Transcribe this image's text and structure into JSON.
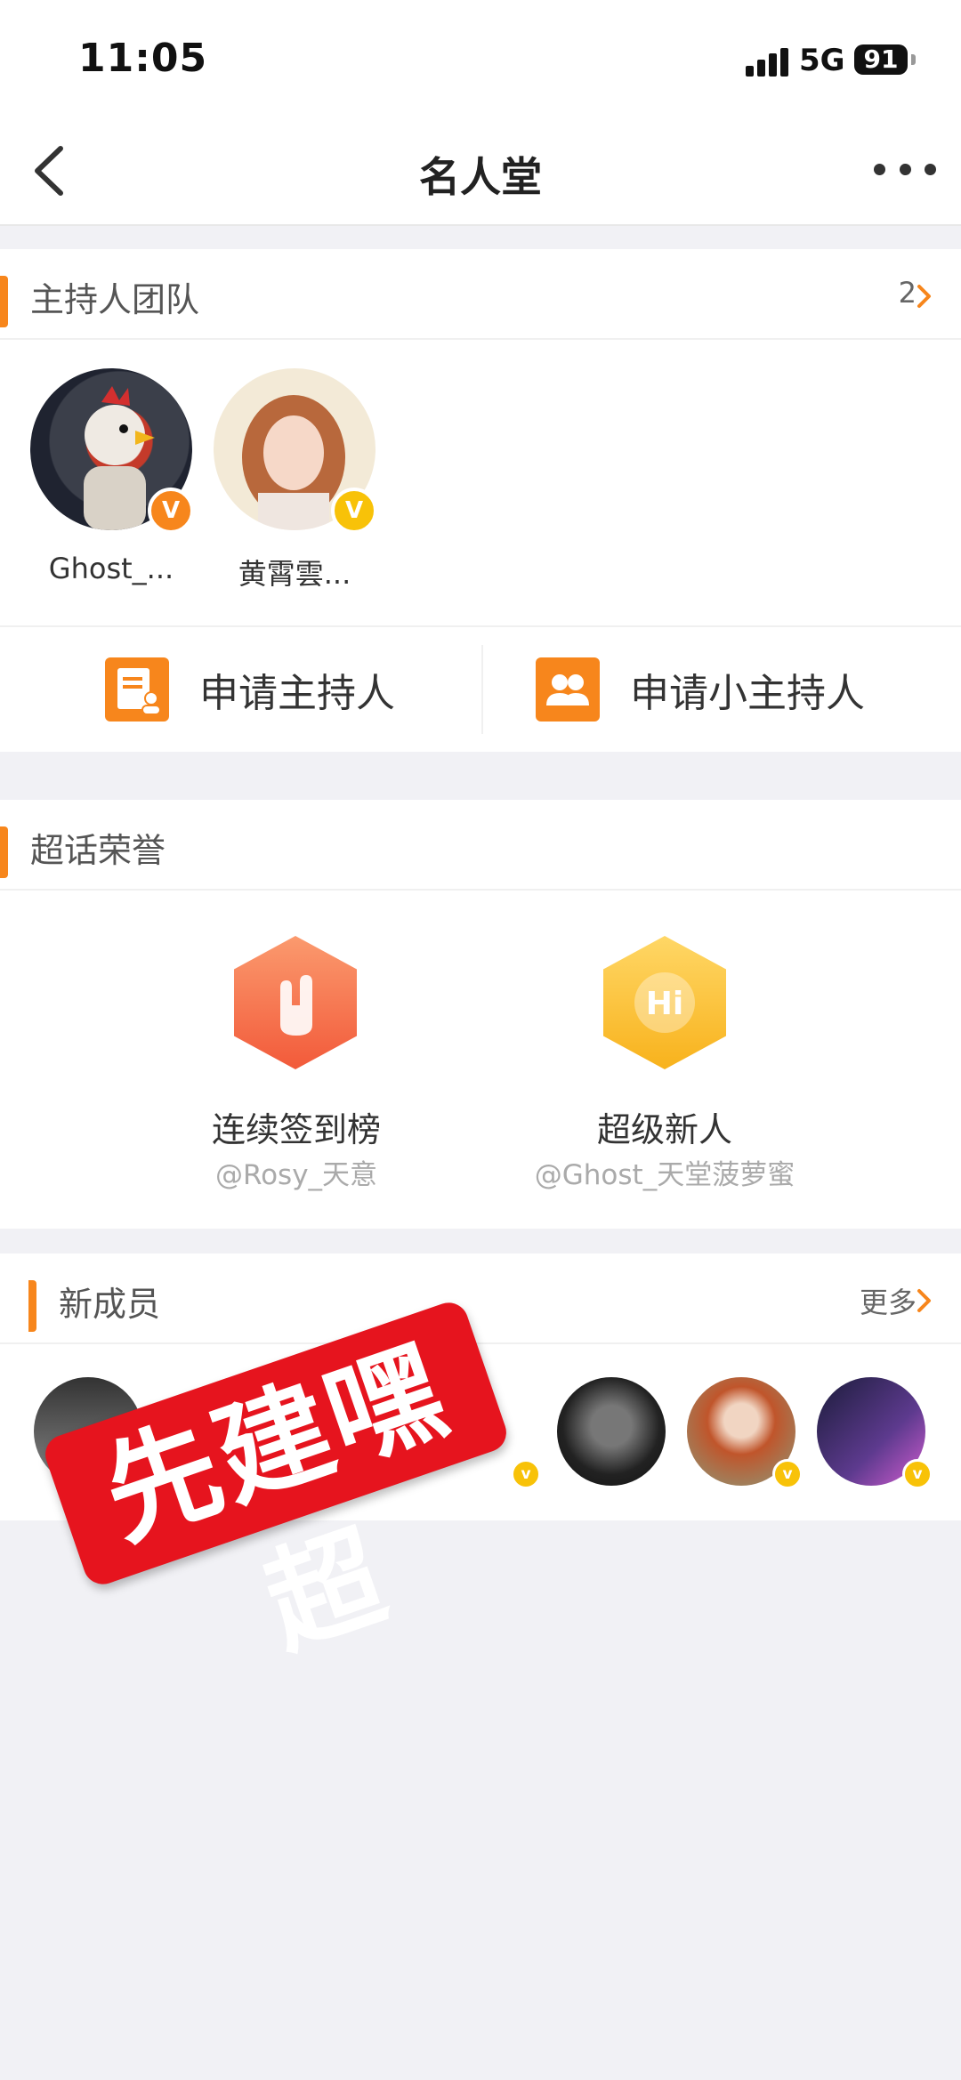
{
  "status": {
    "time": "11:05",
    "network": "5G",
    "battery": "91"
  },
  "nav": {
    "title": "名人堂"
  },
  "hosts": {
    "title": "主持人团队",
    "count": "2",
    "items": [
      {
        "name": "Ghost_..."
      },
      {
        "name": "黄霄雲..."
      }
    ]
  },
  "apply": {
    "host_label": "申请主持人",
    "mini_host_label": "申请小主持人"
  },
  "honor": {
    "title": "超话荣誉",
    "items": [
      {
        "title": "连续签到榜",
        "user": "@Rosy_天意"
      },
      {
        "title": "超级新人",
        "user": "@Ghost_天堂菠萝蜜"
      }
    ]
  },
  "members": {
    "title": "新成员",
    "more_label": "更多"
  },
  "stamp_text": "先建嘿超",
  "colors": {
    "accent": "#f7861c",
    "verified_yellow": "#f8c208",
    "stamp_red": "#e6141e"
  }
}
